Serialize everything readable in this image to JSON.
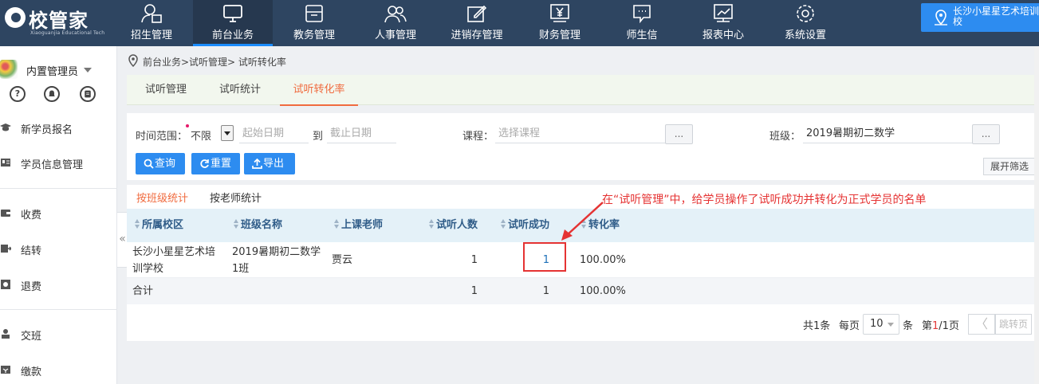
{
  "logo": {
    "name": "校管家",
    "tagline": "Xiaoguanjia Educational Tech"
  },
  "top_nav": [
    {
      "label": "招生管理",
      "icon": "person-add-icon",
      "active": false
    },
    {
      "label": "前台业务",
      "icon": "monitor-icon",
      "active": true
    },
    {
      "label": "教务管理",
      "icon": "tray-icon",
      "active": false
    },
    {
      "label": "人事管理",
      "icon": "people-icon",
      "active": false
    },
    {
      "label": "进销存管理",
      "icon": "edit-icon",
      "active": false
    },
    {
      "label": "财务管理",
      "icon": "yen-icon",
      "active": false
    },
    {
      "label": "师生信",
      "icon": "message-icon",
      "active": false
    },
    {
      "label": "报表中心",
      "icon": "report-icon",
      "active": false
    },
    {
      "label": "系统设置",
      "icon": "gear-icon",
      "active": false
    }
  ],
  "school": {
    "name": "长沙小星星艺术培训学校",
    "icon": "location-pin-icon"
  },
  "user": {
    "name": "内置管理员",
    "quick_icons": [
      "help-icon",
      "bell-icon",
      "chat-icon"
    ]
  },
  "sidebar": {
    "items": [
      {
        "label": "新学员报名",
        "icon": "graduation-cap-icon"
      },
      {
        "label": "学员信息管理",
        "icon": "id-card-icon"
      },
      {
        "label": "收费",
        "icon": "wallet-icon"
      },
      {
        "label": "结转",
        "icon": "transfer-icon"
      },
      {
        "label": "退费",
        "icon": "refund-icon"
      },
      {
        "label": "交班",
        "icon": "handover-icon"
      },
      {
        "label": "缴款",
        "icon": "payment-icon"
      }
    ],
    "collapse_glyph": "«"
  },
  "breadcrumb": "前台业务>试听管理> 试听转化率",
  "subtabs": [
    {
      "label": "试听管理",
      "active": false
    },
    {
      "label": "试听统计",
      "active": false
    },
    {
      "label": "试听转化率",
      "active": true
    }
  ],
  "filters": {
    "time_range_label": "时间范围：",
    "time_range_value": "不限",
    "start_placeholder": "起始日期",
    "to_label": "到",
    "end_placeholder": "截止日期",
    "course_label": "课程：",
    "course_placeholder": "选择课程",
    "class_label": "班级：",
    "class_value": "2019暑期初二数学",
    "dots": "...",
    "query_label": "查询",
    "reset_label": "重置",
    "export_label": "导出",
    "expand_label": "展开筛选"
  },
  "result_tabs": [
    {
      "label": "按班级统计",
      "active": true
    },
    {
      "label": "按老师统计",
      "active": false
    }
  ],
  "table": {
    "columns": [
      "所属校区",
      "班级名称",
      "上课老师",
      "试听人数",
      "试听成功",
      "转化率"
    ],
    "rows": [
      {
        "campus_line1": "长沙小星星艺术培",
        "campus_line2": "训学校",
        "class_line1": "2019暑期初二数学",
        "class_line2": "1班",
        "teacher": "贾云",
        "trial_count": "1",
        "trial_success": "1",
        "conversion": "100.00%"
      }
    ],
    "total": {
      "label": "合计",
      "trial_count": "1",
      "trial_success": "1",
      "conversion": "100.00%"
    }
  },
  "pagination": {
    "total_text": "共1条",
    "per_page_label": "每页",
    "page_size": "10",
    "per_page_unit": "条",
    "page_prefix": "第",
    "current_page": "1",
    "page_suffix": "/1页",
    "prev_glyph": "〈",
    "jump_label": "跳转页"
  },
  "annotation": {
    "text": "在“试听管理”中，给学员操作了试听成功并转化为正式学员的名单",
    "color": "#e53333"
  },
  "colors": {
    "nav_bg": "#2e4561",
    "primary": "#2d8cf0",
    "accent_orange": "#f06b3f",
    "header_blue": "#e4f1f8"
  }
}
